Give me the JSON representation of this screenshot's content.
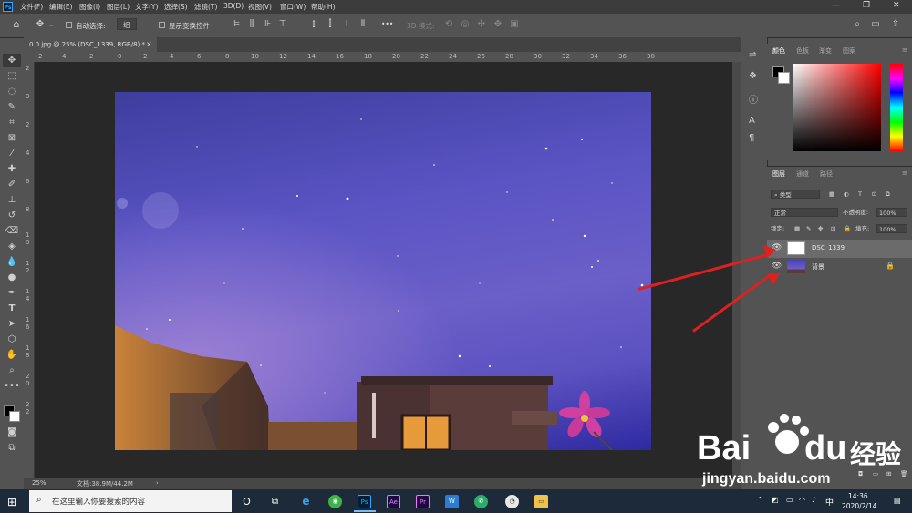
{
  "menubar": {
    "items": [
      "文件(F)",
      "编辑(E)",
      "图像(I)",
      "图层(L)",
      "文字(Y)",
      "选择(S)",
      "滤镜(T)",
      "3D(D)",
      "视图(V)",
      "窗口(W)",
      "帮助(H)"
    ],
    "window_controls": [
      "—",
      "❐",
      "✕"
    ]
  },
  "options": {
    "auto_select_label": "自动选择:",
    "auto_select_value": "组",
    "show_transform_label": "显示变换控件",
    "mode_3d_label": "3D 模式:",
    "more": "•••"
  },
  "document": {
    "tab_title": "0.0.jpg @ 25% (DSC_1339, RGB/8) *",
    "close": "×"
  },
  "ruler": {
    "top_ticks": [
      "2",
      "4",
      "2",
      "0",
      "2",
      "4",
      "6",
      "8",
      "10",
      "12",
      "14",
      "16",
      "18",
      "20",
      "22",
      "24",
      "26",
      "28",
      "30",
      "32",
      "34",
      "36",
      "38"
    ],
    "left_ticks": [
      "2",
      "0",
      "2",
      "4",
      "6",
      "8",
      "1\n0",
      "1\n2",
      "1\n4",
      "1\n6",
      "1\n8",
      "2\n0",
      "2\n2"
    ]
  },
  "status": {
    "zoom": "25%",
    "doc_size": "文档:38.9M/44.2M",
    "arrow": "›"
  },
  "color_panel": {
    "tabs": [
      "颜色",
      "色板",
      "渐变",
      "图案"
    ],
    "active_tab": 0,
    "foreground": "#000000",
    "background": "#ffffff"
  },
  "layers_panel": {
    "tabs": [
      "图层",
      "通道",
      "路径"
    ],
    "active_tab": 0,
    "filter_label": "类型",
    "blend_mode": "正常",
    "opacity_label": "不透明度:",
    "opacity_value": "100%",
    "lock_label": "锁定:",
    "fill_label": "填充:",
    "fill_value": "100%",
    "layers": [
      {
        "name": "DSC_1339",
        "selected": true,
        "locked": false
      },
      {
        "name": "背景",
        "selected": false,
        "locked": true
      }
    ]
  },
  "taskbar": {
    "search_placeholder": "在这里输入你要搜索的内容",
    "apps": [
      "O",
      "⧉",
      "e",
      "◉",
      "Ps",
      "Ae",
      "Pr",
      "W",
      "✆",
      "◔",
      "▭"
    ],
    "time": "14:36",
    "date": "2020/2/14",
    "ime": "中"
  },
  "watermark": {
    "brand": "Bai",
    "brand2": "du",
    "cn": "经验",
    "url": "jingyan.baidu.com"
  },
  "colors": {
    "accent_arrow": "#e02020",
    "ps_blue": "#31a8ff",
    "sky": "#5a54c4"
  }
}
